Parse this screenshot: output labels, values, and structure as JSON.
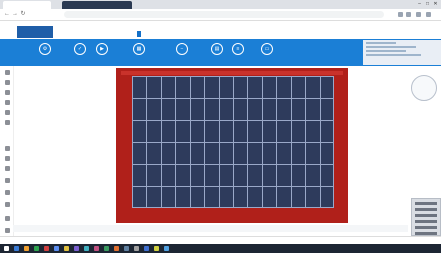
{
  "browser": {
    "tabs": [
      {
        "label": "",
        "active": true
      },
      {
        "label": "",
        "active": false
      }
    ],
    "url": "",
    "window_controls": [
      "–",
      "□",
      "✕"
    ]
  },
  "app": {
    "logo_text": "",
    "menu_tabs": [
      {
        "label": ""
      },
      {
        "label": ""
      },
      {
        "label": ""
      },
      {
        "label": ""
      },
      {
        "label": ""
      },
      {
        "label": ""
      },
      {
        "label": "",
        "active": true
      },
      {
        "label": ""
      },
      {
        "label": ""
      },
      {
        "label": ""
      },
      {
        "label": ""
      },
      {
        "label": ""
      },
      {
        "label": ""
      }
    ],
    "ribbon_buttons": [
      {
        "label": "",
        "icon": "gear-icon",
        "glyph": "⚙"
      },
      {
        "label": "",
        "icon": "check-icon",
        "glyph": "✓"
      },
      {
        "label": "",
        "icon": "play-icon",
        "glyph": "▶"
      },
      {
        "label": "",
        "icon": "panel-icon",
        "glyph": "▦"
      },
      {
        "label": "",
        "icon": "minus-icon",
        "glyph": "−"
      },
      {
        "label": "",
        "icon": "grid-icon",
        "glyph": "▤"
      },
      {
        "label": "",
        "icon": "list-icon",
        "glyph": "≡"
      },
      {
        "label": "",
        "icon": "card-icon",
        "glyph": "▭"
      }
    ]
  },
  "canvas": {
    "colors": {
      "roof": "#b0201a",
      "panel_fill": "#2e3b5c",
      "panel_lines": "#9aa8c8",
      "ribbon": "#1b7fd6"
    },
    "panel_columns": 14,
    "panel_rows": 6,
    "compass_label": ""
  },
  "taskbar": {
    "clock": ""
  }
}
